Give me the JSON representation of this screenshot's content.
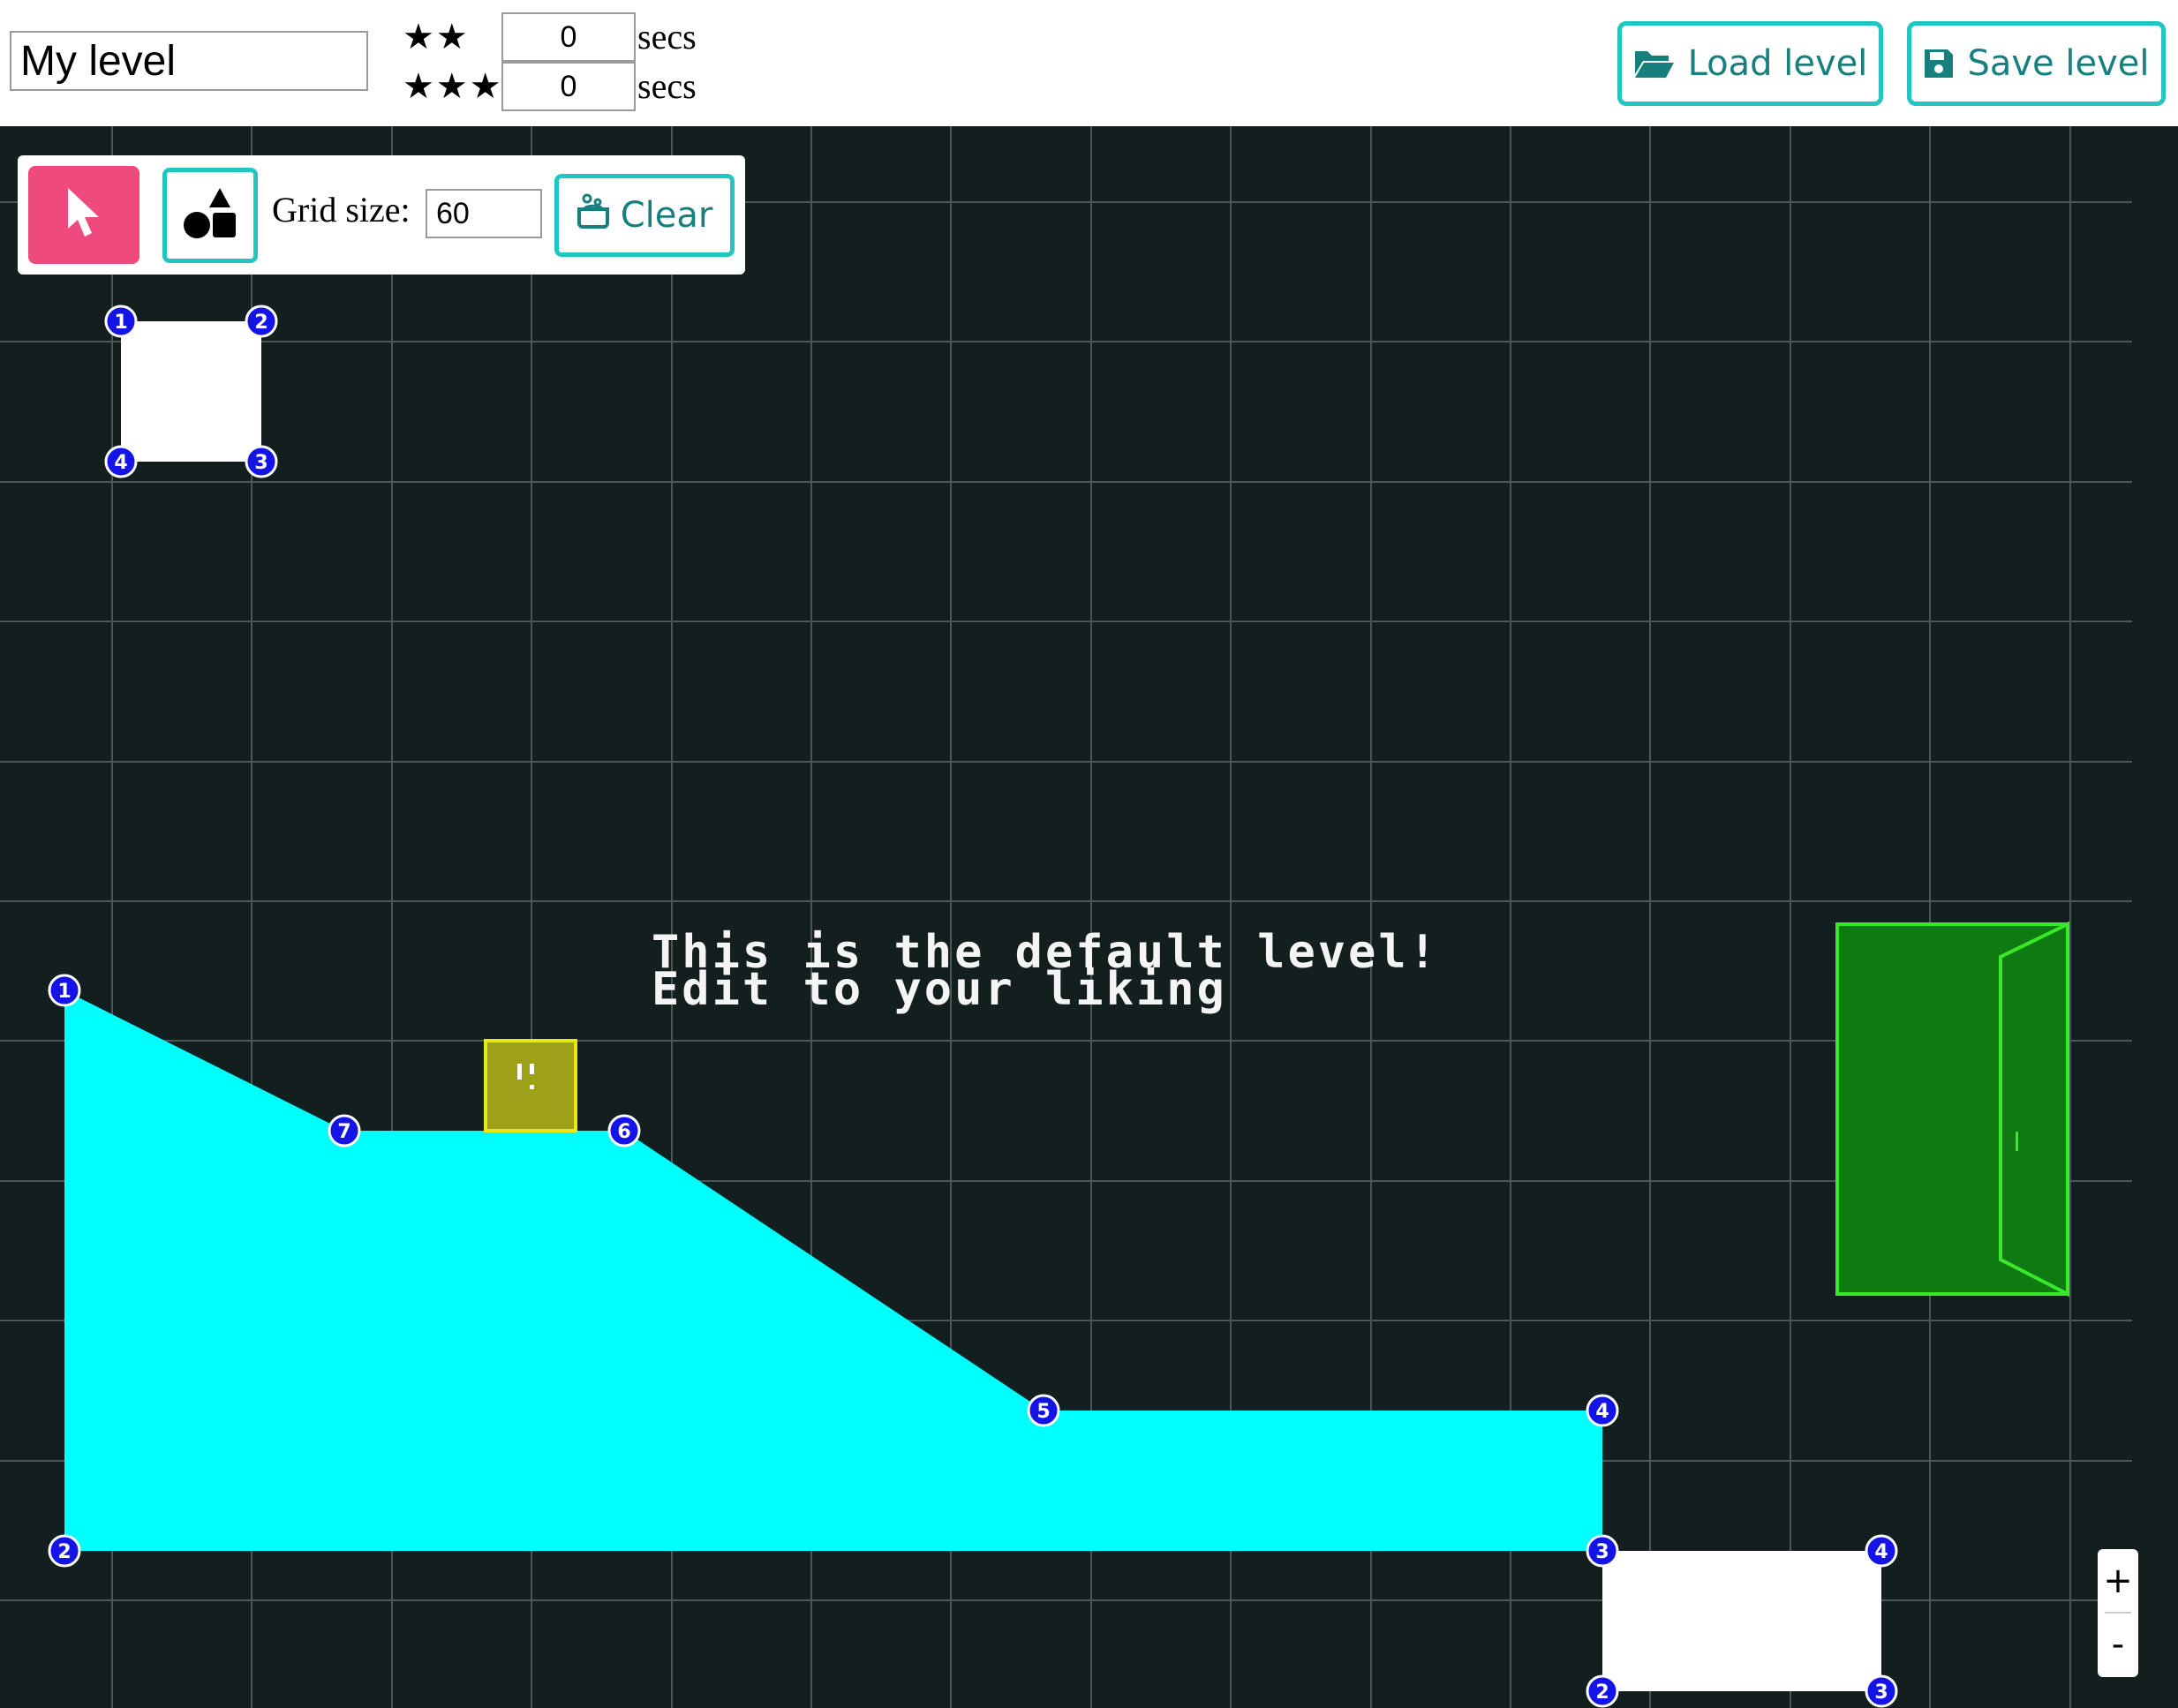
{
  "header": {
    "level_name": "My level",
    "two_star_symbol": "★★",
    "two_star_secs": "0",
    "three_star_symbol": "★★★",
    "three_star_secs": "0",
    "secs_label": "secs",
    "load_label": "Load level",
    "save_label": "Save level",
    "load_icon": "folder-open-icon",
    "save_icon": "floppy-disk-icon"
  },
  "toolbar": {
    "select_icon": "cursor-arrow-icon",
    "shapes_icon": "shapes-icon",
    "grid_size_label": "Grid size:",
    "grid_size_value": "60",
    "clear_label": "Clear",
    "clear_icon": "soap-icon"
  },
  "canvas": {
    "default_text_line1": "This is the default level!",
    "default_text_line2": "Edit to your liking",
    "vertex_labels": {
      "top_white": [
        "1",
        "2",
        "3",
        "4"
      ],
      "cyan": [
        "1",
        "2",
        "3",
        "4",
        "5",
        "6",
        "7"
      ],
      "bottom_white": [
        "2",
        "3",
        "4"
      ]
    }
  },
  "zoom": {
    "in_label": "+",
    "out_label": "-"
  },
  "colors": {
    "canvas_bg": "#131f1f",
    "grid": "#4b5656",
    "cyan_shape": "#00ffff",
    "white_shape": "#ffffff",
    "door_fill": "#0f7a12",
    "door_stroke": "#39e829",
    "player_fill": "#9fa01a",
    "player_stroke": "#e8e817",
    "vertex_fill": "#1414e6",
    "accent_teal": "#21c6c0",
    "select_pink": "#ee4a7e"
  }
}
